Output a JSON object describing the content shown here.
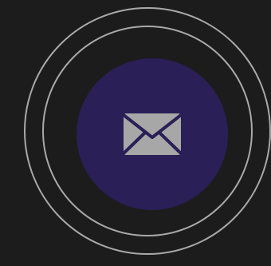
{
  "screen": {
    "background_color": "#1c1c1c",
    "ring_color": "#a9a9a9",
    "badge_color": "#2a1f56",
    "icon_color": "#a7a7a7",
    "icon_accent_color": "#2a1f56",
    "icon": "mail-envelope-icon"
  }
}
